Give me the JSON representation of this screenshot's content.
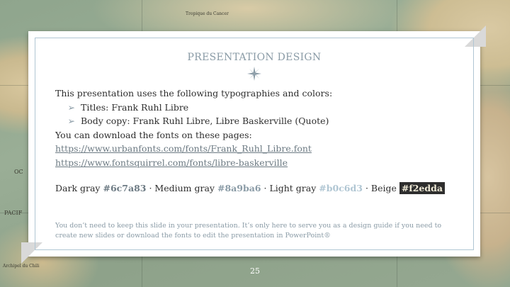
{
  "slide": {
    "title": "PRESENTATION DESIGN",
    "intro": "This presentation uses the following typographies and colors:",
    "bullets": [
      "Titles: Frank Ruhl Libre",
      "Body copy: Frank Ruhl Libre, Libre Baskerville (Quote)"
    ],
    "download_text": "You can download the fonts on these pages:",
    "links": [
      "https://www.urbanfonts.com/fonts/Frank_Ruhl_Libre.font",
      "https://www.fontsquirrel.com/fonts/libre-baskerville"
    ],
    "colors": {
      "dark_label": "Dark gray",
      "dark_hex": "#6c7a83",
      "medium_label": "Medium gray",
      "medium_hex": "#8a9ba6",
      "light_label": "Light gray",
      "light_hex": "#b0c6d3",
      "beige_label": "Beige",
      "beige_hex": "#f2edda",
      "separator": "·"
    },
    "note": "You don’t need to keep this slide in your presentation. It’s only here to serve you as a design guide if you need to create new slides or download the fonts to edit the presentation in PowerPoint®",
    "page_number": "25"
  },
  "map_labels": [
    "Tropique du Cancer",
    "PACIF",
    "OC",
    "Archipel du Chili"
  ],
  "icons": {
    "divider": "compass-star-icon",
    "bullet": "arrow-bullet-icon"
  },
  "theme": {
    "accent": "#8a9ba6",
    "border": "#b0c6d3",
    "text": "#2e2e2e"
  }
}
